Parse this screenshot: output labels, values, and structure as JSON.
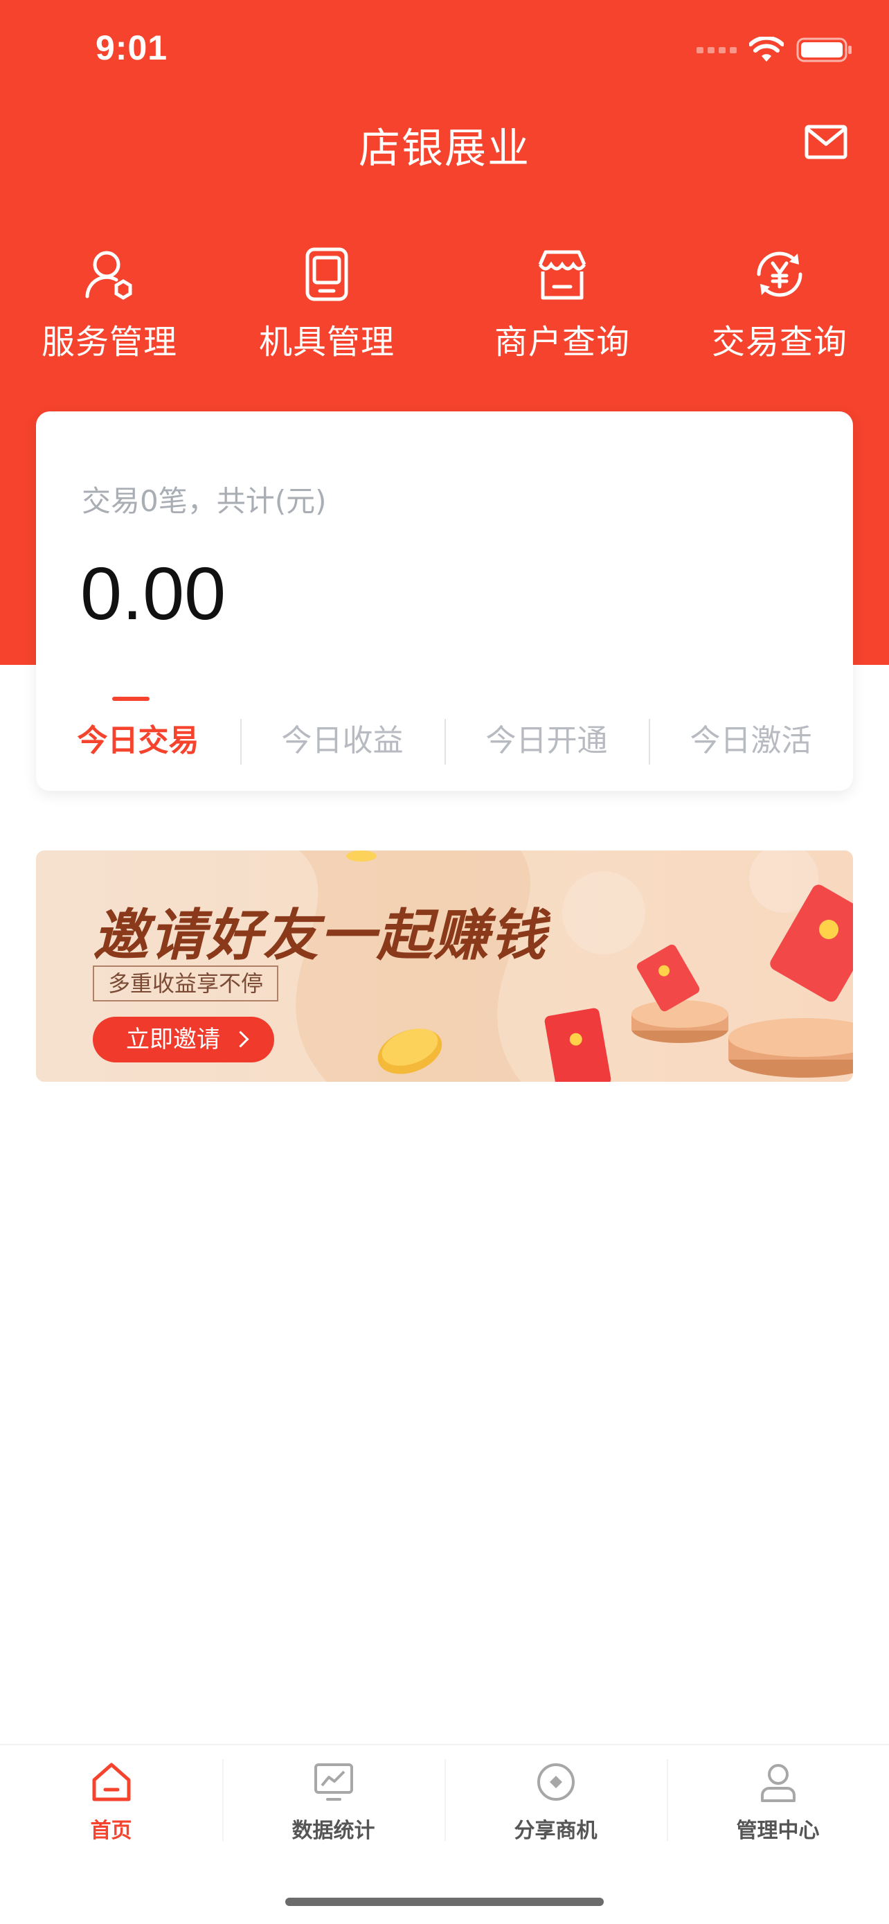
{
  "status_bar": {
    "time": "9:01"
  },
  "header": {
    "title": "店银展业",
    "mail_icon": "mail-icon"
  },
  "quick_nav": [
    {
      "label": "服务管理",
      "icon": "service-icon"
    },
    {
      "label": "机具管理",
      "icon": "device-icon"
    },
    {
      "label": "商户查询",
      "icon": "store-icon"
    },
    {
      "label": "交易查询",
      "icon": "yuan-exchange-icon"
    }
  ],
  "summary": {
    "caption": "交易0笔，共计(元)",
    "amount": "0.00",
    "tabs": [
      {
        "label": "今日交易",
        "active": true
      },
      {
        "label": "今日收益",
        "active": false
      },
      {
        "label": "今日开通",
        "active": false
      },
      {
        "label": "今日激活",
        "active": false
      }
    ]
  },
  "banner": {
    "title": "邀请好友一起赚钱",
    "subtitle": "多重收益享不停",
    "button_label": "立即邀请"
  },
  "tabbar": [
    {
      "label": "首页",
      "icon": "home-icon",
      "active": true
    },
    {
      "label": "数据统计",
      "icon": "chart-icon",
      "active": false
    },
    {
      "label": "分享商机",
      "icon": "share-icon",
      "active": false
    },
    {
      "label": "管理中心",
      "icon": "user-icon",
      "active": false
    }
  ],
  "colors": {
    "brand": "#f5432d",
    "inactive_text": "#b7bac0"
  }
}
